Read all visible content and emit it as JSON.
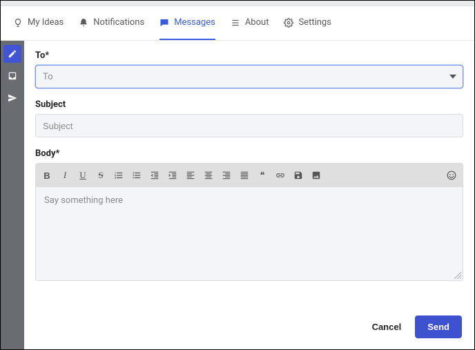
{
  "tabs": {
    "ideas": "My Ideas",
    "notifications": "Notifications",
    "messages": "Messages",
    "about": "About",
    "settings": "Settings"
  },
  "form": {
    "to_label": "To*",
    "to_placeholder": "To",
    "subject_label": "Subject",
    "subject_placeholder": "Subject",
    "body_label": "Body*",
    "body_placeholder": "Say something here"
  },
  "toolbar": {
    "bold": "B",
    "italic": "I",
    "underline": "U",
    "strike": "S",
    "quote": "❝"
  },
  "actions": {
    "cancel": "Cancel",
    "send": "Send"
  }
}
